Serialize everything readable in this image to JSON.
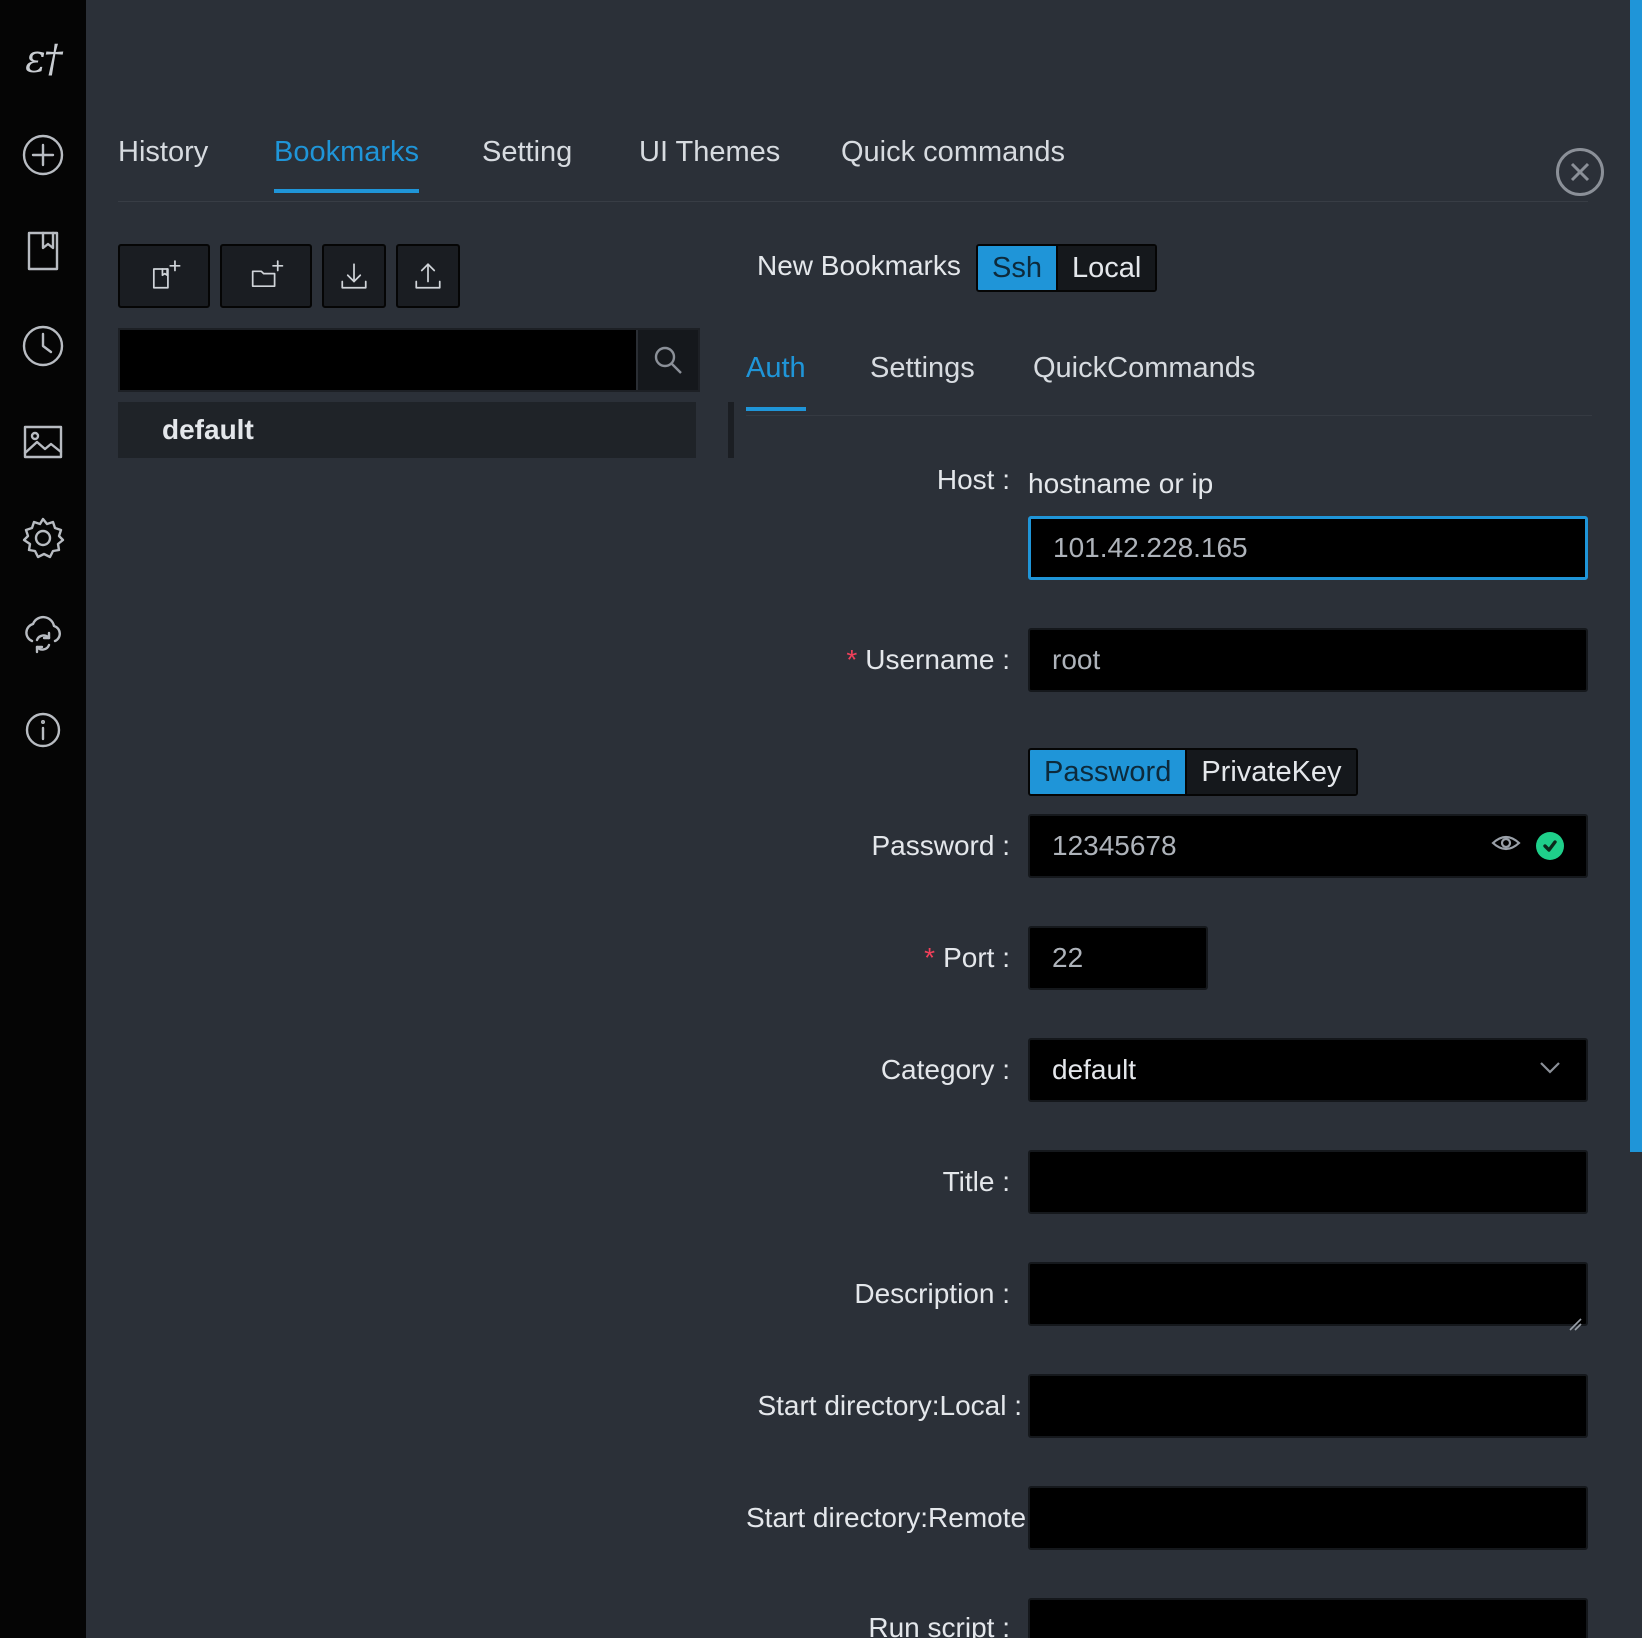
{
  "rail": {
    "logo": "ɛ†",
    "items": [
      {
        "icon": "plus-circle-icon"
      },
      {
        "icon": "bookmark-icon"
      },
      {
        "icon": "clock-icon"
      },
      {
        "icon": "image-icon"
      },
      {
        "icon": "gear-icon"
      },
      {
        "icon": "cloud-sync-icon"
      },
      {
        "icon": "info-icon"
      }
    ]
  },
  "top_tabs": [
    {
      "label": "History"
    },
    {
      "label": "Bookmarks",
      "active": true
    },
    {
      "label": "Setting"
    },
    {
      "label": "UI Themes"
    },
    {
      "label": "Quick commands"
    }
  ],
  "toolbar": {
    "new_bookmark_icon": "new-bookmark-icon",
    "new_category_icon": "new-folder-icon",
    "import_icon": "download-icon",
    "export_icon": "upload-icon"
  },
  "search": {
    "value": "",
    "placeholder": ""
  },
  "tree": {
    "items": [
      {
        "label": "default"
      }
    ]
  },
  "panel": {
    "title": "New Bookmarks",
    "type_options": [
      {
        "label": "Ssh",
        "active": true
      },
      {
        "label": "Local"
      }
    ],
    "sub_tabs": [
      {
        "label": "Auth",
        "active": true
      },
      {
        "label": "Settings"
      },
      {
        "label": "QuickCommands"
      }
    ]
  },
  "form": {
    "host": {
      "label": "Host",
      "hint": "hostname or ip",
      "value": "101.42.228.165"
    },
    "username": {
      "label": "Username",
      "value": "root"
    },
    "auth_modes": [
      {
        "label": "Password",
        "active": true
      },
      {
        "label": "PrivateKey"
      }
    ],
    "password": {
      "label": "Password",
      "value": "12345678"
    },
    "port": {
      "label": "Port",
      "value": "22"
    },
    "category": {
      "label": "Category",
      "value": "default"
    },
    "title": {
      "label": "Title",
      "value": ""
    },
    "description": {
      "label": "Description",
      "value": ""
    },
    "start_local": {
      "label": "Start directory:Local",
      "value": ""
    },
    "start_remote": {
      "label": "Start directory:Remote",
      "value": ""
    },
    "run_script": {
      "label": "Run script",
      "value": ""
    }
  },
  "colors": {
    "accent": "#1f95d8",
    "required": "#f0405a",
    "ok": "#1fcf8a",
    "bg": "#2b3038",
    "rail": "#050505"
  }
}
